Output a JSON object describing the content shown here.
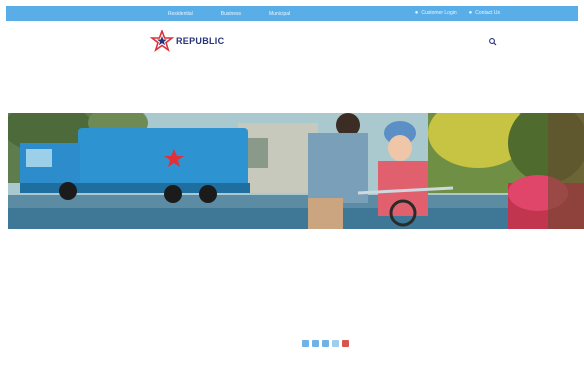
{
  "topbar": {
    "nav": [
      "Residential",
      "Business",
      "Municipal"
    ],
    "utility": [
      {
        "label": "Customer Login",
        "icon": "lock-icon"
      },
      {
        "label": "Contact Us",
        "icon": "user-icon"
      }
    ]
  },
  "header": {
    "logo_text": "REPUBLIC",
    "search_icon": "search-icon"
  },
  "carousel": {
    "slide_count": 5,
    "active_index": 4
  },
  "colors": {
    "topbar": "#5aaee8",
    "brand_navy": "#27337a",
    "brand_red": "#e0303a",
    "dot": "#6fb3e6",
    "dot_active": "#d9534f"
  }
}
